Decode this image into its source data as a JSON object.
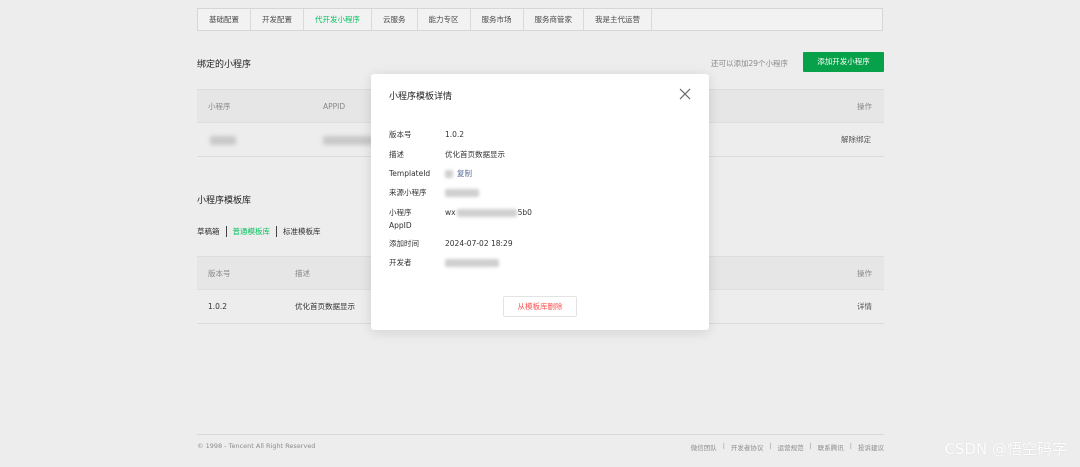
{
  "tabs": [
    {
      "label": "基础配置"
    },
    {
      "label": "开发配置"
    },
    {
      "label": "代开发小程序",
      "active": true
    },
    {
      "label": "云服务"
    },
    {
      "label": "能力专区"
    },
    {
      "label": "服务市场"
    },
    {
      "label": "服务商管家"
    },
    {
      "label": "我是主代运营"
    }
  ],
  "bound": {
    "title": "绑定的小程序",
    "quota_text": "还可以添加29个小程序",
    "add_button": "添加开发小程序",
    "columns": [
      "小程序",
      "APPID",
      "操作"
    ],
    "row_action": "解除绑定"
  },
  "library": {
    "title": "小程序模板库",
    "subtabs": [
      {
        "label": "草稿箱"
      },
      {
        "label": "普通模板库",
        "active": true
      },
      {
        "label": "标准模板库"
      }
    ],
    "columns": [
      "版本号",
      "描述",
      "操作"
    ],
    "rows": [
      {
        "version": "1.0.2",
        "desc": "优化首页数据显示",
        "action": "详情"
      }
    ]
  },
  "modal": {
    "title": "小程序模板详情",
    "fields": {
      "version_label": "版本号",
      "version_value": "1.0.2",
      "desc_label": "描述",
      "desc_value": "优化首页数据显示",
      "template_label": "TemplateId",
      "copy_label": "复制",
      "source_label": "来源小程序",
      "appid_label_1": "小程序",
      "appid_label_2": "AppID",
      "appid_prefix": "wx",
      "appid_suffix": "5b0",
      "added_label": "添加时间",
      "added_value": "2024-07-02 18:29",
      "developer_label": "开发者"
    },
    "delete_button": "从模板库删除"
  },
  "footer": {
    "copyright": "© 1998 - Tencent All Right Reserved",
    "links": [
      "微信团队",
      "开发者协议",
      "运营规范",
      "联系腾讯",
      "投诉建议"
    ]
  },
  "watermark": "CSDN @悟空码字",
  "colors": {
    "accent": "#07c160",
    "danger": "#fa5151",
    "link": "#576b95"
  }
}
